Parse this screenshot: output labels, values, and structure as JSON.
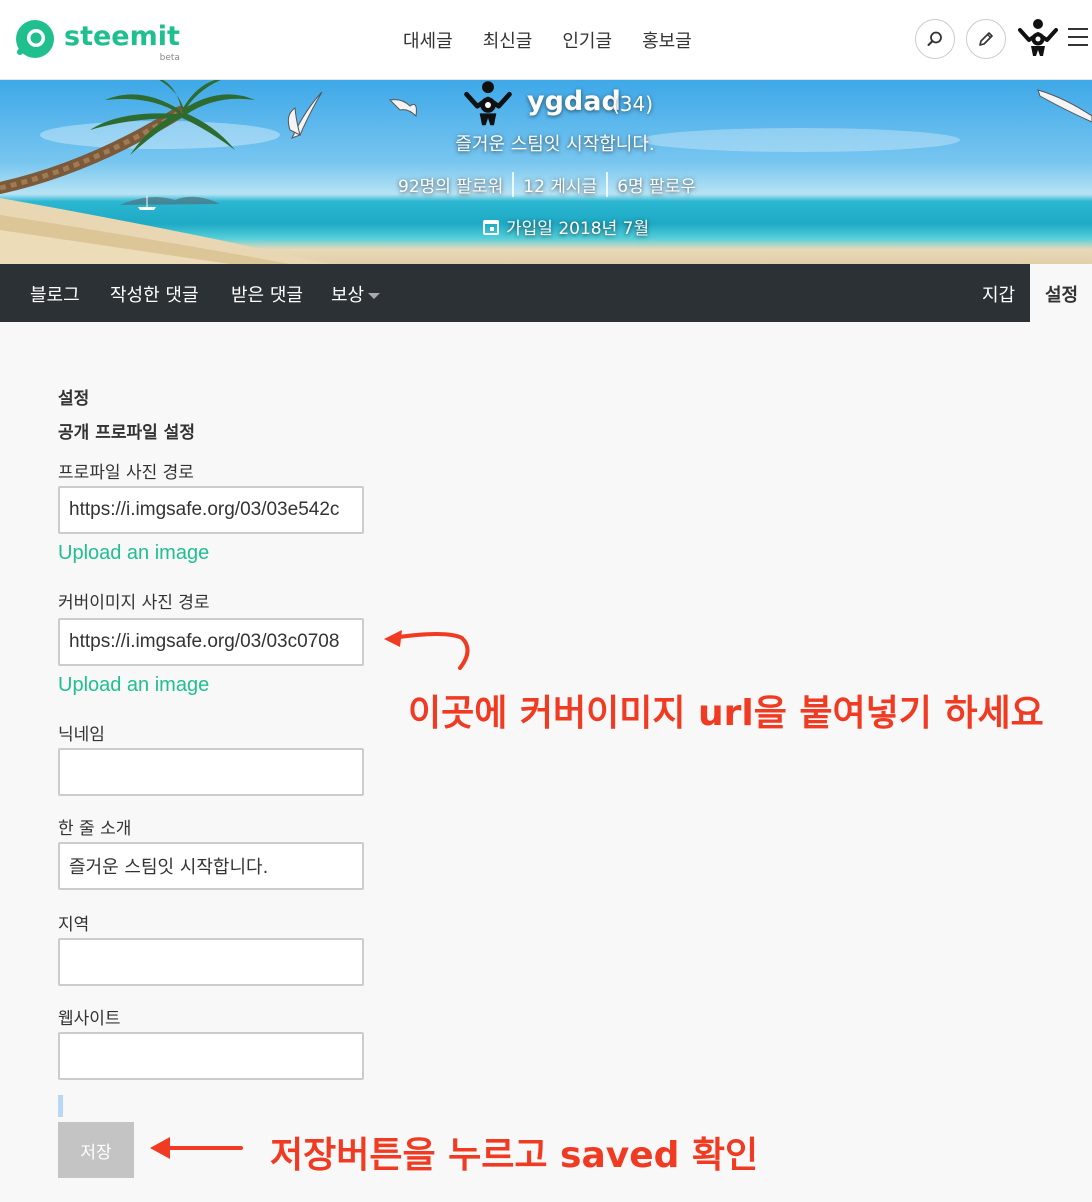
{
  "header": {
    "logo_text": "steemit",
    "logo_beta": "beta",
    "nav": [
      "대세글",
      "최신글",
      "인기글",
      "홍보글"
    ],
    "brand_color": "#1fbf8f"
  },
  "profile": {
    "name": "ygdad",
    "reputation": "(34)",
    "about": "즐거운 스팀잇 시작합니다.",
    "followers": "92명의 팔로워",
    "posts": "12 게시글",
    "following": "6명 팔로우",
    "joined": "가입일 2018년 7월"
  },
  "tabs": {
    "blog": "블로그",
    "comments": "작성한 댓글",
    "replies": "받은 댓글",
    "rewards": "보상",
    "wallet": "지갑",
    "settings": "설정"
  },
  "form": {
    "heading": "설정",
    "subheading": "공개 프로파일 설정",
    "profile_image_label": "프로파일 사진 경로",
    "profile_image_value": "https://i.imgsafe.org/03/03e542c",
    "upload_label": "Upload an image",
    "cover_image_label": "커버이미지 사진 경로",
    "cover_image_value": "https://i.imgsafe.org/03/03c0708",
    "nickname_label": "닉네임",
    "nickname_value": "",
    "about_label": "한 줄 소개",
    "about_value": "즐거운 스팀잇 시작합니다.",
    "location_label": "지역",
    "location_value": "",
    "website_label": "웹사이트",
    "website_value": "",
    "save_label": "저장"
  },
  "annotations": {
    "cover_hint": "이곳에 커버이미지 url을 붙여넣기 하세요",
    "save_hint": "저장버튼을 누르고 saved 확인",
    "color": "#f03b22"
  }
}
